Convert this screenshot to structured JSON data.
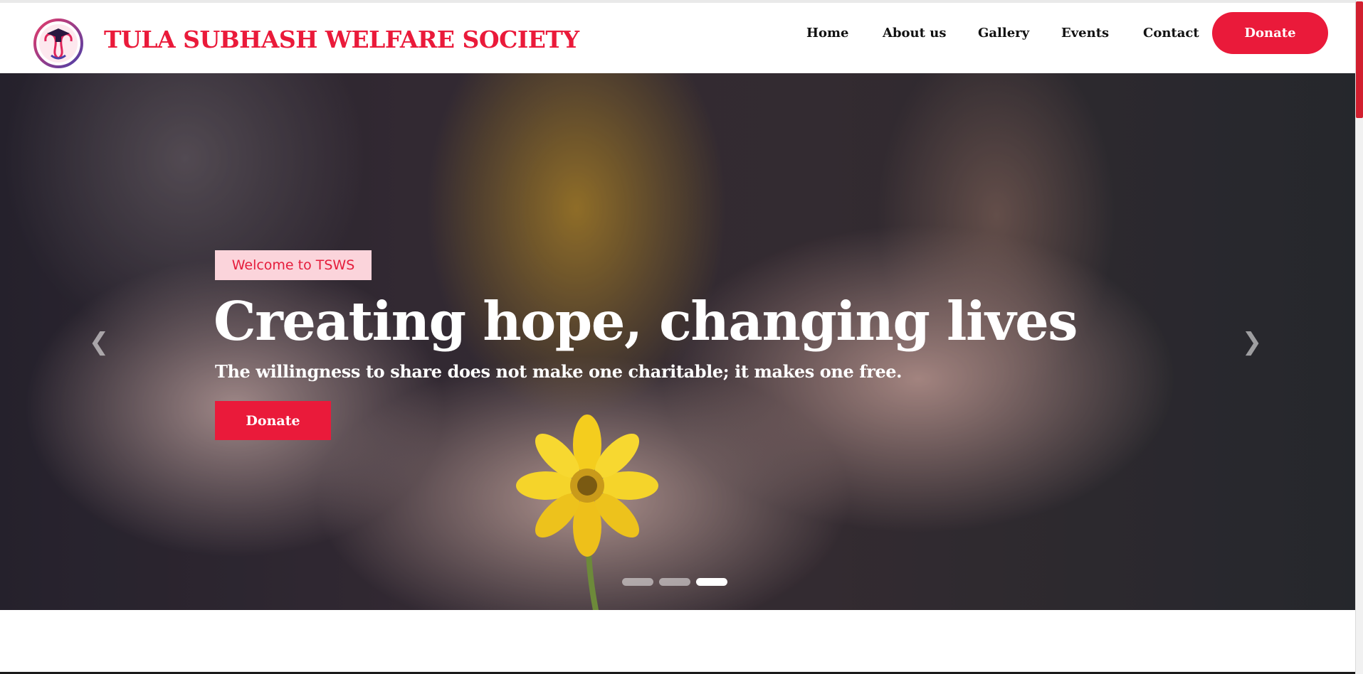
{
  "header": {
    "brand": "TULA SUBHASH WELFARE SOCIETY",
    "logo_icon": "tsws-logo-icon",
    "nav": [
      "Home",
      "About us",
      "Gallery",
      "Events",
      "Contact"
    ],
    "donate_label": "Donate"
  },
  "hero": {
    "badge": "Welcome to TSWS",
    "headline": "Creating hope, changing lives",
    "subline": "The willingness to share does not make one charitable; it makes one free.",
    "donate_label": "Donate",
    "prev_icon": "chevron-left-icon",
    "next_icon": "chevron-right-icon",
    "slide_count": 3,
    "active_slide": 3
  },
  "colors": {
    "accent": "#ea1a3a",
    "badge_bg": "#fbd4db"
  }
}
